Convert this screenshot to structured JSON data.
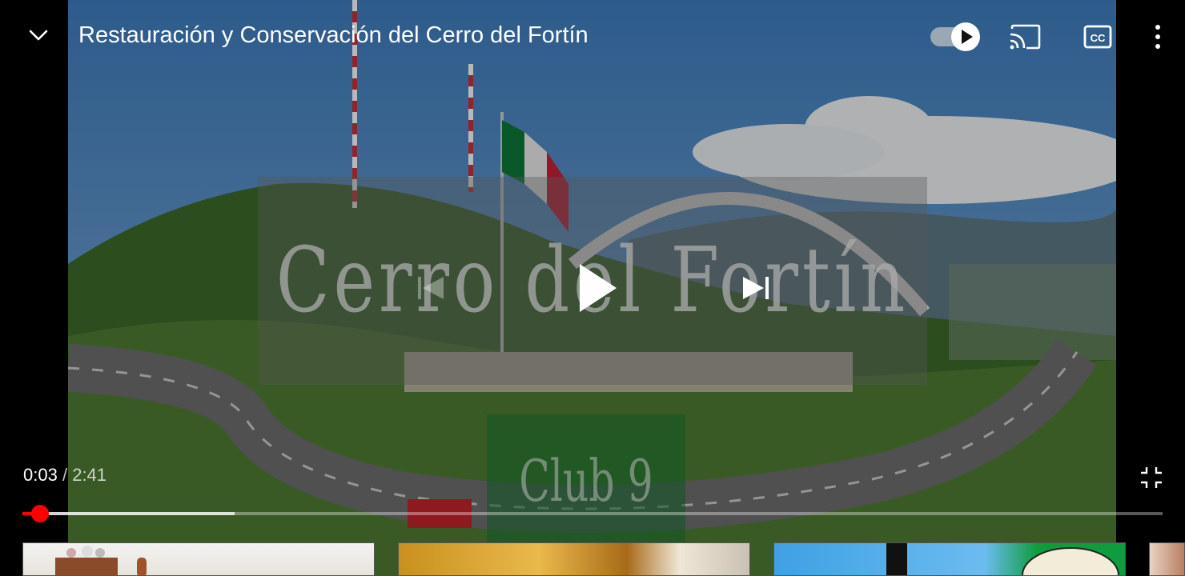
{
  "video": {
    "title": "Restauración y Conservación del Cerro del Fortín",
    "overlay_title": "Cerro del Fortín",
    "overlay_subtitle": "Club 9"
  },
  "top_bar": {
    "collapse_icon": "chevron-down-icon",
    "autoplay_icon": "autoplay-toggle-icon",
    "cast_icon": "cast-icon",
    "cc_label": "CC",
    "more_icon": "more-vertical-icon"
  },
  "center_controls": {
    "previous_icon": "skip-previous-icon",
    "play_icon": "play-icon",
    "next_icon": "skip-next-icon"
  },
  "playback": {
    "current_time": "0:03",
    "separator": "/",
    "duration": "2:41",
    "played_fraction": 0.0155,
    "buffered_fraction": 0.186,
    "exit_fullscreen_icon": "exit-fullscreen-icon"
  },
  "colors": {
    "progress": "#ff0000",
    "text": "#ffffff"
  },
  "suggestions": [
    {
      "id": "thumb-1"
    },
    {
      "id": "thumb-2"
    },
    {
      "id": "thumb-3"
    },
    {
      "id": "thumb-4"
    }
  ]
}
